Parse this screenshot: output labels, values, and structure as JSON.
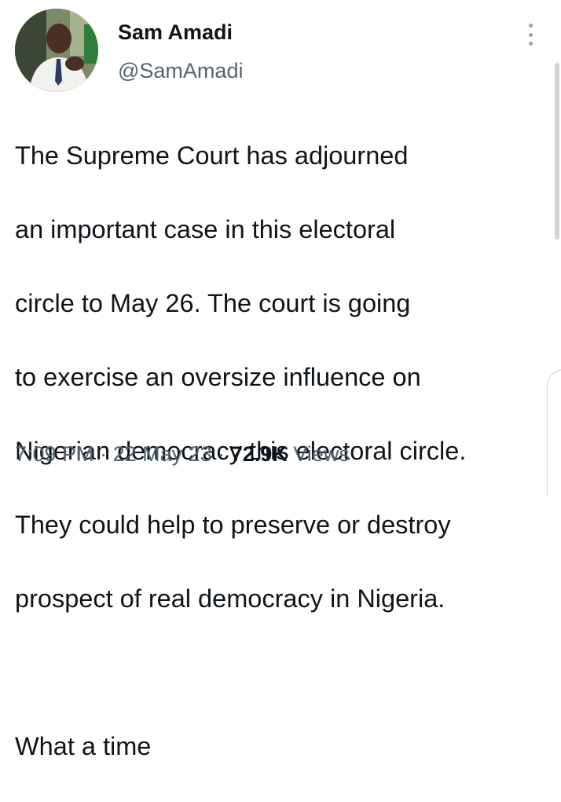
{
  "author": {
    "display_name": "Sam Amadi",
    "handle": "@SamAmadi"
  },
  "tweet": {
    "lines": [
      "The Supreme Court has adjourned",
      "an important case in this electoral",
      "circle to May 26. The court is going",
      "to exercise an oversize influence on",
      "Nigerian democracy this electoral circle.",
      "They could help to preserve or destroy",
      "prospect of real democracy in Nigeria.",
      "",
      "What a time"
    ]
  },
  "meta": {
    "time": "7:09 PM",
    "separator": "·",
    "date": "22 May 23",
    "views_count": "72.9K",
    "views_label": "Views"
  },
  "icons": {
    "more": "more-vertical-icon"
  },
  "colors": {
    "text": "#0f1419",
    "secondary_text": "#536471",
    "background": "#ffffff"
  }
}
